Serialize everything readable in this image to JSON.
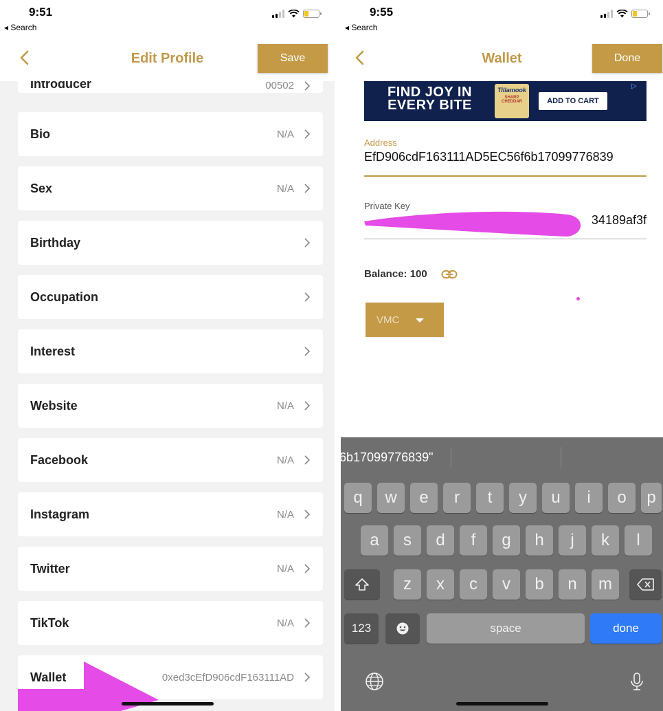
{
  "colors": {
    "accent": "#c49a46",
    "title": "#c19a49",
    "annotation": "#e54be6",
    "keyboard_done": "#2f7af6"
  },
  "left_screen": {
    "status": {
      "time": "9:51",
      "back_label": "◂ Search"
    },
    "nav": {
      "title": "Edit Profile",
      "save_label": "Save",
      "back_icon": "chevron-left-icon"
    },
    "partial_row": {
      "label": "Introducer",
      "value": "00502"
    },
    "rows": [
      {
        "label": "Bio",
        "value": "N/A"
      },
      {
        "label": "Sex",
        "value": "N/A"
      },
      {
        "label": "Birthday",
        "value": ""
      },
      {
        "label": "Occupation",
        "value": ""
      },
      {
        "label": "Interest",
        "value": ""
      },
      {
        "label": "Website",
        "value": "N/A"
      },
      {
        "label": "Facebook",
        "value": "N/A"
      },
      {
        "label": "Instagram",
        "value": "N/A"
      },
      {
        "label": "Twitter",
        "value": "N/A"
      },
      {
        "label": "TikTok",
        "value": "N/A"
      },
      {
        "label": "Wallet",
        "value": "0xed3cEfD906cdF163111AD"
      }
    ]
  },
  "right_screen": {
    "status": {
      "time": "9:55",
      "back_label": "◂ Search"
    },
    "nav": {
      "title": "Wallet",
      "done_label": "Done"
    },
    "ad": {
      "headline_line1": "FIND JOY IN",
      "headline_line2": "EVERY BITE",
      "brand": "Tillamook",
      "product": "SHARP CHEDDAR",
      "cta": "ADD TO CART"
    },
    "address": {
      "label": "Address",
      "value": "EfD906cdF163111AD5EC56f6b17099776839"
    },
    "private_key": {
      "label": "Private Key",
      "visible_suffix": "34189af3f"
    },
    "balance": {
      "text": "Balance: 100",
      "icon": "link-icon"
    },
    "currency_select": {
      "value": "VMC"
    },
    "keyboard": {
      "suggestion": "6b17099776839\"",
      "row1": [
        "q",
        "w",
        "e",
        "r",
        "t",
        "y",
        "u",
        "i",
        "o",
        "p"
      ],
      "row2": [
        "a",
        "s",
        "d",
        "f",
        "g",
        "h",
        "j",
        "k",
        "l"
      ],
      "row3": [
        "z",
        "x",
        "c",
        "v",
        "b",
        "n",
        "m"
      ],
      "numbers_label": "123",
      "space_label": "space",
      "done_label": "done"
    }
  }
}
